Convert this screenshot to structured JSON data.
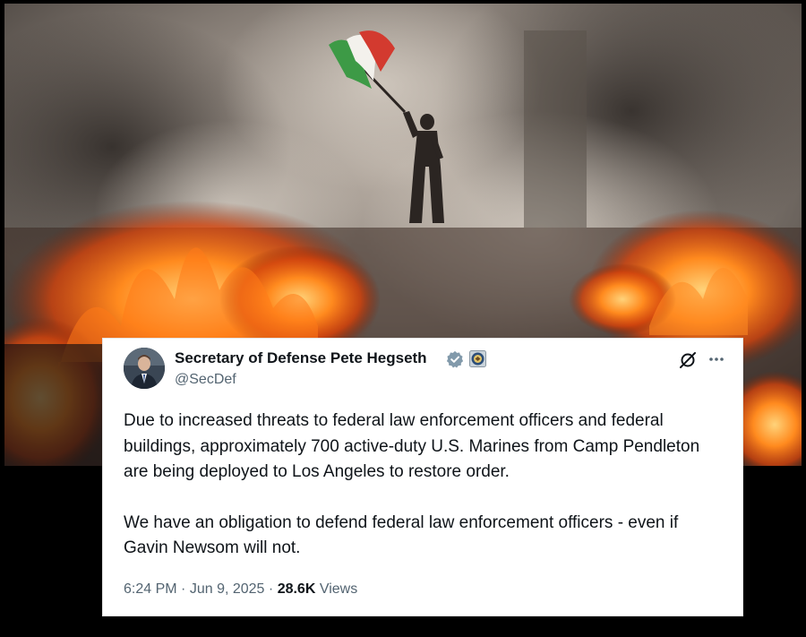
{
  "tweet": {
    "author_name": "Secretary of Defense Pete Hegseth",
    "handle": "@SecDef",
    "paragraphs": [
      "Due to increased threats to federal law enforcement officers and federal buildings, approximately 700 active-duty U.S. Marines from Camp Pendleton are being deployed to Los Angeles to restore order.",
      "We have an obligation to defend federal law enforcement officers - even if Gavin Newsom will not."
    ],
    "time": "6:24 PM",
    "date": "Jun 9, 2025",
    "separator": "·",
    "views_count": "28.6K",
    "views_label": "Views"
  },
  "icons": {
    "verified": "verified-badge-icon",
    "affiliation": "government-seal-icon",
    "grok": "grok-icon",
    "more": "more-options-icon"
  },
  "colors": {
    "card_background": "#ffffff",
    "text_primary": "#0f1419",
    "text_secondary": "#536471",
    "verified_badge": "#829aab",
    "page_background": "#000000"
  }
}
